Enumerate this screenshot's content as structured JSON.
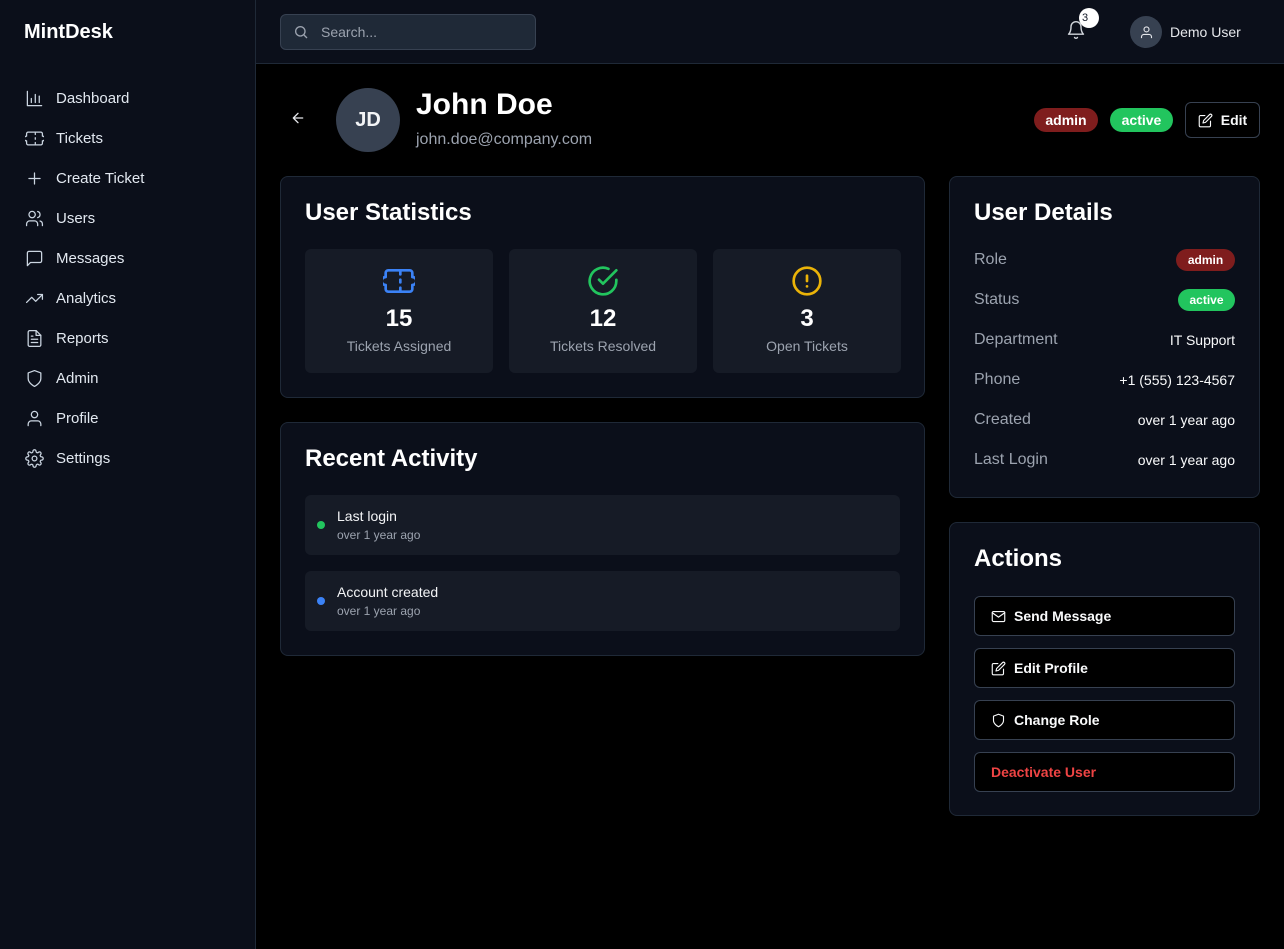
{
  "app": {
    "brand": "MintDesk"
  },
  "sidebar": {
    "items": [
      {
        "label": "Dashboard",
        "icon": "bar-chart-icon"
      },
      {
        "label": "Tickets",
        "icon": "ticket-icon"
      },
      {
        "label": "Create Ticket",
        "icon": "plus-icon"
      },
      {
        "label": "Users",
        "icon": "users-icon"
      },
      {
        "label": "Messages",
        "icon": "message-icon"
      },
      {
        "label": "Analytics",
        "icon": "trending-up-icon"
      },
      {
        "label": "Reports",
        "icon": "file-text-icon"
      },
      {
        "label": "Admin",
        "icon": "shield-icon"
      },
      {
        "label": "Profile",
        "icon": "user-icon"
      },
      {
        "label": "Settings",
        "icon": "gear-icon"
      }
    ]
  },
  "topbar": {
    "search_placeholder": "Search...",
    "notifications_count": "3",
    "user_name": "Demo User"
  },
  "profile": {
    "initials": "JD",
    "name": "John Doe",
    "email": "john.doe@company.com",
    "role_badge": "admin",
    "status_badge": "active",
    "edit_label": "Edit"
  },
  "stats": {
    "title": "User Statistics",
    "items": [
      {
        "value": "15",
        "label": "Tickets Assigned",
        "icon": "ticket-icon",
        "color": "#3b82f6"
      },
      {
        "value": "12",
        "label": "Tickets Resolved",
        "icon": "check-circle-icon",
        "color": "#22c55e"
      },
      {
        "value": "3",
        "label": "Open Tickets",
        "icon": "alert-circle-icon",
        "color": "#eab308"
      }
    ]
  },
  "activity": {
    "title": "Recent Activity",
    "items": [
      {
        "title": "Last login",
        "time": "over 1 year ago",
        "dot_color": "#22c55e"
      },
      {
        "title": "Account created",
        "time": "over 1 year ago",
        "dot_color": "#3b82f6"
      }
    ]
  },
  "details": {
    "title": "User Details",
    "role_label": "Role",
    "role_value": "admin",
    "status_label": "Status",
    "status_value": "active",
    "department_label": "Department",
    "department_value": "IT Support",
    "phone_label": "Phone",
    "phone_value": "+1 (555) 123-4567",
    "created_label": "Created",
    "created_value": "over 1 year ago",
    "last_login_label": "Last Login",
    "last_login_value": "over 1 year ago"
  },
  "actions": {
    "title": "Actions",
    "send_message": "Send Message",
    "edit_profile": "Edit Profile",
    "change_role": "Change Role",
    "deactivate": "Deactivate User"
  },
  "colors": {
    "admin_badge": "#7f1d1d",
    "active_badge": "#22c55e",
    "danger": "#ef4444"
  }
}
